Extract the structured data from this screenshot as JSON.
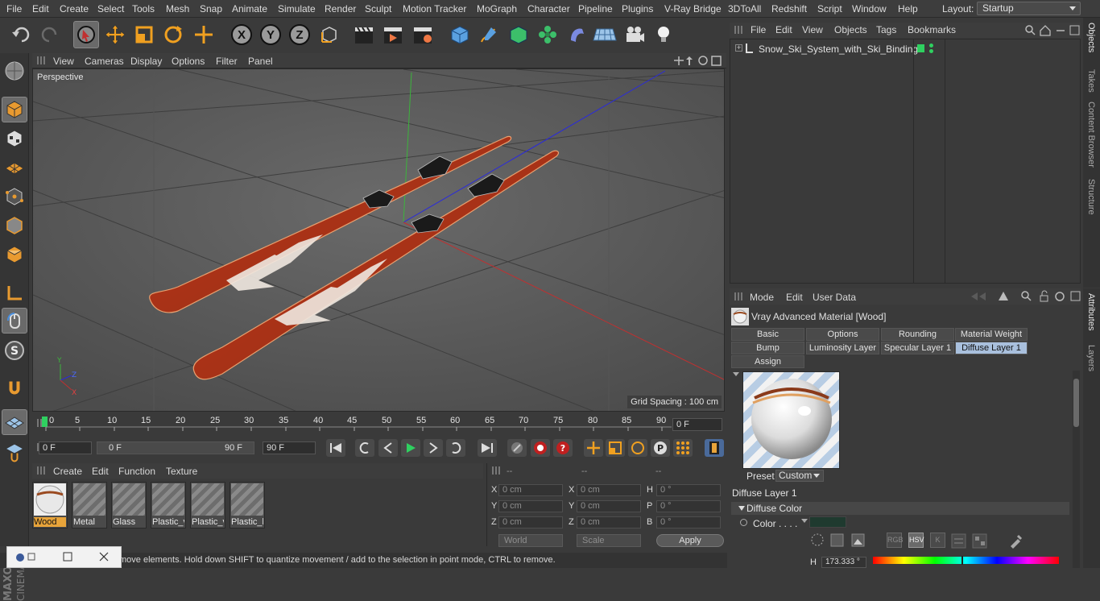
{
  "menu": [
    "File",
    "Edit",
    "Create",
    "Select",
    "Tools",
    "Mesh",
    "Snap",
    "Animate",
    "Simulate",
    "Render",
    "Sculpt",
    "Motion Tracker",
    "MoGraph",
    "Character",
    "Pipeline",
    "Plugins",
    "V-Ray Bridge",
    "3DToAll",
    "Redshift",
    "Script",
    "Window",
    "Help"
  ],
  "layout": {
    "label": "Layout:",
    "value": "Startup"
  },
  "toolbar": {
    "x": "X",
    "y": "Y",
    "z": "Z"
  },
  "viewport": {
    "menu": [
      "View",
      "Cameras",
      "Display",
      "Options",
      "Filter",
      "Panel"
    ],
    "label": "Perspective",
    "grid_spacing": "Grid Spacing : 100 cm"
  },
  "timeline": {
    "ticks": [
      "0",
      "5",
      "10",
      "15",
      "20",
      "25",
      "30",
      "35",
      "40",
      "45",
      "50",
      "55",
      "60",
      "65",
      "70",
      "75",
      "80",
      "85",
      "90"
    ],
    "current_frame": "0 F"
  },
  "playback": {
    "start": "0 F",
    "range_start": "0 F",
    "range_end": "90 F",
    "end": "90 F"
  },
  "materials": {
    "menu": [
      "Create",
      "Edit",
      "Function",
      "Texture"
    ],
    "items": [
      "Wood",
      "Metal",
      "Glass",
      "Plastic_v",
      "Plastic_v",
      "Plastic_b"
    ]
  },
  "coords": {
    "headers": [
      "--",
      "--",
      "--"
    ],
    "rows": [
      {
        "a": "X",
        "av": "0 cm",
        "b": "X",
        "bv": "0 cm",
        "c": "H",
        "cv": "0 °"
      },
      {
        "a": "Y",
        "av": "0 cm",
        "b": "Y",
        "bv": "0 cm",
        "c": "P",
        "cv": "0 °"
      },
      {
        "a": "Z",
        "av": "0 cm",
        "b": "Z",
        "bv": "0 cm",
        "c": "B",
        "cv": "0 °"
      }
    ],
    "space": "World",
    "mode": "Scale",
    "apply": "Apply"
  },
  "status": "move elements. Hold down SHIFT to quantize movement / add to the selection in point mode, CTRL to remove.",
  "objects": {
    "menu": [
      "File",
      "Edit",
      "View",
      "Objects",
      "Tags",
      "Bookmarks"
    ],
    "items": [
      "Snow_Ski_System_with_Ski_Bindings"
    ]
  },
  "side_tabs_top": [
    "Objects",
    "Takes",
    "Content Browser",
    "Structure"
  ],
  "side_tabs_bottom": [
    "Attributes",
    "Layers"
  ],
  "attributes": {
    "menu": [
      "Mode",
      "Edit",
      "User Data"
    ],
    "title": "Vray Advanced Material [Wood]",
    "tabs_row1": [
      "Basic",
      "Options",
      "Rounding",
      "Material Weight"
    ],
    "tabs_row2": [
      "Bump",
      "Luminosity Layer",
      "Specular Layer 1",
      "Diffuse Layer 1"
    ],
    "tabs_row3": [
      "Assign"
    ],
    "active_tab": "Diffuse Layer 1",
    "preset_label": "Preset",
    "preset_value": "Custom",
    "section": "Diffuse Layer 1",
    "subsection": "Diffuse Color",
    "color_label": "Color . . . .",
    "color_modes": [
      "RGB",
      "HSV",
      "K"
    ],
    "h_label": "H",
    "h_value": "173.333 °",
    "color_value": "#1f3a2f"
  }
}
